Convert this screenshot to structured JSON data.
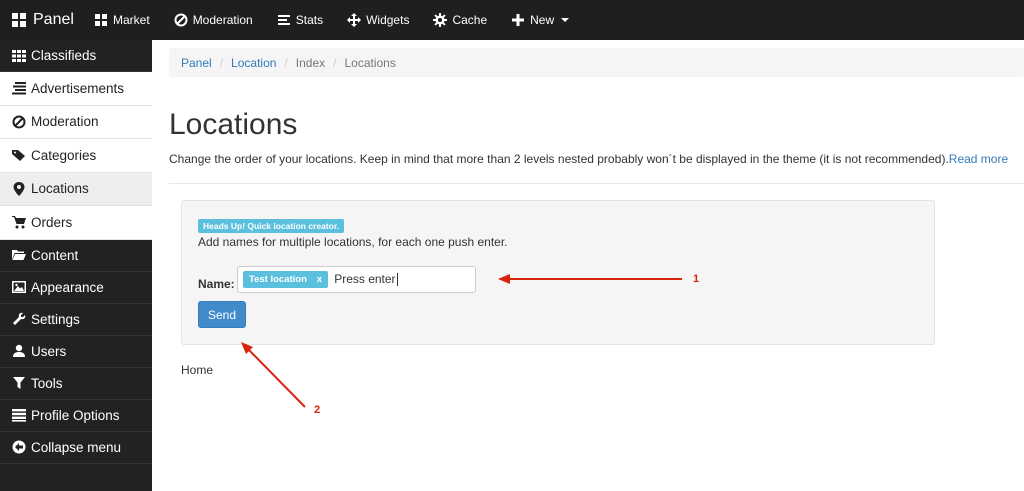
{
  "topbar": {
    "brand": "Panel",
    "items": [
      {
        "label": "Market",
        "icon": "market-icon"
      },
      {
        "label": "Moderation",
        "icon": "ban-icon"
      },
      {
        "label": "Stats",
        "icon": "stats-icon"
      },
      {
        "label": "Widgets",
        "icon": "move-icon"
      },
      {
        "label": "Cache",
        "icon": "cog-icon"
      },
      {
        "label": "New",
        "icon": "plus-icon"
      }
    ]
  },
  "sidebar": {
    "items": [
      {
        "label": "Classifieds",
        "icon": "grid-icon"
      },
      {
        "label": "Advertisements",
        "icon": "list-icon"
      },
      {
        "label": "Moderation",
        "icon": "ban-icon"
      },
      {
        "label": "Categories",
        "icon": "tags-icon"
      },
      {
        "label": "Locations",
        "icon": "map-marker-icon"
      },
      {
        "label": "Orders",
        "icon": "cart-icon"
      },
      {
        "label": "Content",
        "icon": "folder-icon"
      },
      {
        "label": "Appearance",
        "icon": "picture-icon"
      },
      {
        "label": "Settings",
        "icon": "wrench-icon"
      },
      {
        "label": "Users",
        "icon": "user-icon"
      },
      {
        "label": "Tools",
        "icon": "filter-icon"
      },
      {
        "label": "Profile Options",
        "icon": "list-lines-icon"
      },
      {
        "label": "Collapse menu",
        "icon": "circle-arrow-left-icon"
      }
    ]
  },
  "breadcrumb": {
    "items": [
      "Panel",
      "Location",
      "Index",
      "Locations"
    ]
  },
  "page": {
    "title": "Locations",
    "description": "Change the order of your locations. Keep in mind that more than 2 levels nested probably won´t be displayed in the theme (it is not recommended).",
    "read_more": "Read more"
  },
  "panel": {
    "badge": "Heads Up! Quick location creator.",
    "description": "Add names for multiple locations, for each one push enter.",
    "name_label": "Name:",
    "tag": "Test location",
    "tag_remove": "x",
    "input_value": "Press enter",
    "send_label": "Send"
  },
  "tree": {
    "root": "Home"
  },
  "annotations": {
    "one": "1",
    "two": "2",
    "color": "#d9230f"
  }
}
